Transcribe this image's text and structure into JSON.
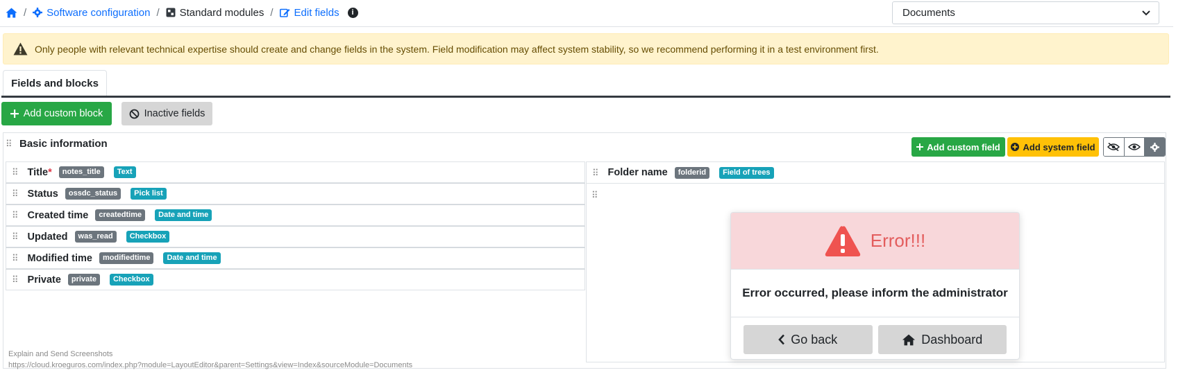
{
  "breadcrumb": {
    "items": [
      {
        "label": "Software configuration"
      },
      {
        "label": "Standard modules"
      },
      {
        "label": "Edit fields"
      }
    ],
    "separator": "/"
  },
  "module_select": {
    "value": "Documents"
  },
  "warning": {
    "text": "Only people with relevant technical expertise should create and change fields in the system. Field modification may affect system stability, so we recommend performing it in a test environment first."
  },
  "tabs": [
    {
      "label": "Fields and blocks"
    }
  ],
  "toolbar": {
    "add_custom_block": "Add custom block",
    "inactive_fields": "Inactive fields"
  },
  "block": {
    "title": "Basic information",
    "add_custom_field": "Add custom field",
    "add_system_field": "Add system field",
    "left_fields": [
      {
        "label": "Title",
        "required_mark": "*",
        "name": "notes_title",
        "type": "Text"
      },
      {
        "label": "Status",
        "name": "ossdc_status",
        "type": "Pick list"
      },
      {
        "label": "Created time",
        "name": "createdtime",
        "type": "Date and time"
      },
      {
        "label": "Updated",
        "name": "was_read",
        "type": "Checkbox"
      },
      {
        "label": "Modified time",
        "name": "modifiedtime",
        "type": "Date and time"
      },
      {
        "label": "Private",
        "name": "private",
        "type": "Checkbox"
      }
    ],
    "right_fields": [
      {
        "label": "Folder name",
        "name": "folderid",
        "type": "Field of trees"
      }
    ]
  },
  "error_modal": {
    "title": "Error!!!",
    "message": "Error occurred, please inform the administrator",
    "go_back": "Go back",
    "dashboard": "Dashboard"
  },
  "overlay": {
    "line1": "Explain and Send Screenshots",
    "line2": "https://cloud.kroeguros.com/index.php?module=LayoutEditor&parent=Settings&view=Index&sourceModule=Documents"
  },
  "colors": {
    "primary": "#0d6efd",
    "success": "#28a745",
    "warning_bg": "#fff3cd",
    "yellow": "#ffc107",
    "name_badge": "#6c757d",
    "type_badge": "#17a2b8",
    "error_bg": "#f8d7da",
    "error_text": "#e35d5d"
  }
}
